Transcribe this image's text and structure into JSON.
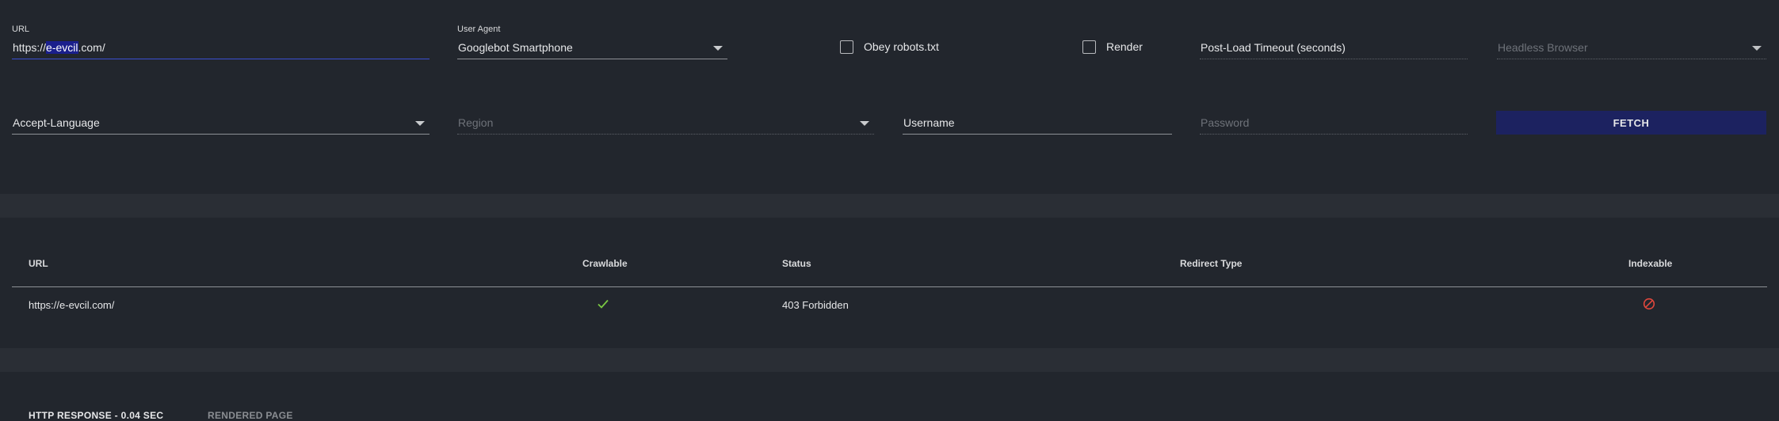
{
  "form": {
    "url": {
      "label": "URL",
      "value_prefix": "https://",
      "value_highlight": "e-evcil",
      "value_suffix": ".com/"
    },
    "user_agent": {
      "label": "User Agent",
      "value": "Googlebot Smartphone"
    },
    "obey_robots": {
      "label": "Obey robots.txt",
      "checked": false
    },
    "render": {
      "label": "Render",
      "checked": false
    },
    "post_load_timeout": {
      "placeholder": "Post-Load Timeout (seconds)"
    },
    "headless_browser": {
      "placeholder": "Headless Browser"
    },
    "accept_language": {
      "placeholder": "Accept-Language"
    },
    "region": {
      "placeholder": "Region"
    },
    "username": {
      "placeholder": "Username"
    },
    "password": {
      "placeholder": "Password"
    },
    "fetch_label": "FETCH"
  },
  "results": {
    "columns": [
      "URL",
      "Crawlable",
      "Status",
      "Redirect Type",
      "Indexable"
    ],
    "rows": [
      {
        "url": "https://e-evcil.com/",
        "crawlable": "yes",
        "status": "403 Forbidden",
        "redirect_type": "",
        "indexable": "no"
      }
    ]
  },
  "tabs": {
    "http_response": "HTTP RESPONSE - 0.04 SEC",
    "rendered_page": "RENDERED PAGE"
  },
  "colors": {
    "background": "#22262d",
    "band": "#2a2e35",
    "accent_blue": "#3b4fd1",
    "fetch_button": "#1c2260",
    "check_green": "#7ac943",
    "block_red": "#e0473c"
  },
  "icons": {
    "crawlable": "check-icon",
    "indexable": "blocked-icon",
    "dropdown": "caret-down-icon"
  }
}
